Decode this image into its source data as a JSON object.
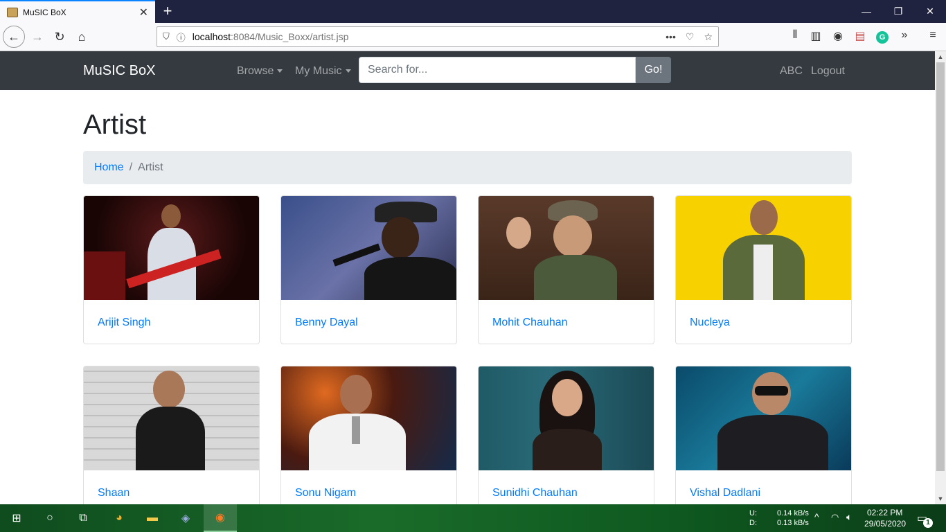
{
  "browser": {
    "tab_title": "MuSIC BoX",
    "url_host": "localhost",
    "url_path": ":8084/Music_Boxx/artist.jsp"
  },
  "app": {
    "brand": "MuSIC BoX",
    "menu_browse": "Browse",
    "menu_my_music": "My Music",
    "search_placeholder": "Search for...",
    "go_label": "Go!",
    "user_name": "ABC",
    "logout_label": "Logout"
  },
  "page": {
    "title": "Artist",
    "breadcrumb_home": "Home",
    "breadcrumb_sep": "/",
    "breadcrumb_current": "Artist"
  },
  "artists": [
    {
      "name": "Arijit Singh"
    },
    {
      "name": "Benny Dayal"
    },
    {
      "name": "Mohit Chauhan"
    },
    {
      "name": "Nucleya"
    },
    {
      "name": "Shaan"
    },
    {
      "name": "Sonu Nigam"
    },
    {
      "name": "Sunidhi Chauhan"
    },
    {
      "name": "Vishal Dadlani"
    }
  ],
  "taskbar": {
    "upload_label": "U:",
    "download_label": "D:",
    "upload_speed": "0.14 kB/s",
    "download_speed": "0.13 kB/s",
    "time": "02:22 PM",
    "date": "29/05/2020",
    "notification_count": "1"
  }
}
